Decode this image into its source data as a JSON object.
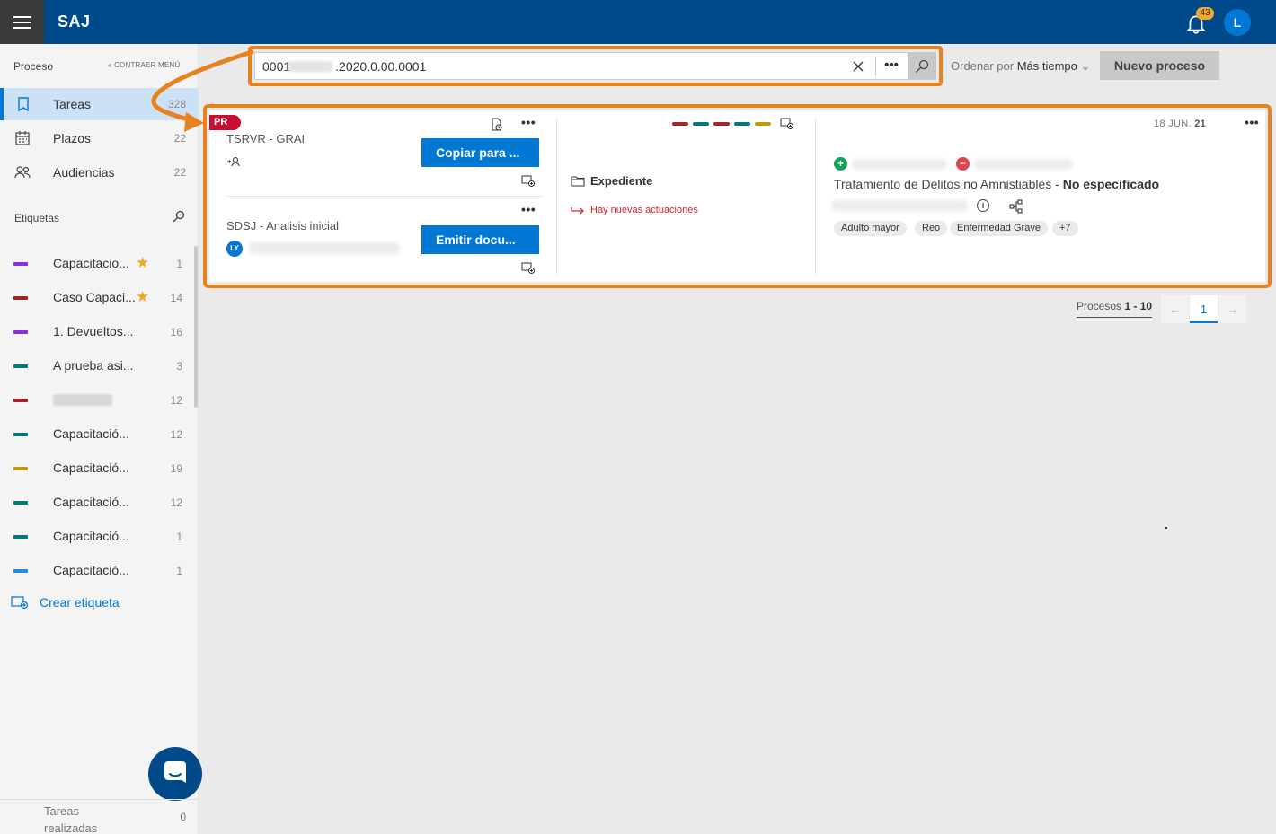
{
  "header": {
    "brand": "SAJ",
    "notifications_count": "43",
    "user_initial": "L"
  },
  "sidebar": {
    "section_title": "Proceso",
    "collapse_label": "« CONTRAER MENÚ",
    "nav": [
      {
        "label": "Tareas",
        "count": "328",
        "icon": "bookmark-icon",
        "active": true
      },
      {
        "label": "Plazos",
        "count": "22",
        "icon": "calendar-icon",
        "active": false
      },
      {
        "label": "Audiencias",
        "count": "22",
        "icon": "people-icon",
        "active": false
      }
    ],
    "tags_title": "Etiquetas",
    "tags": [
      {
        "label": "Capacitacio...",
        "count": "1",
        "color": "#8a2be2",
        "starred": true
      },
      {
        "label": "Caso Capaci...",
        "count": "14",
        "color": "#a4262c",
        "starred": true
      },
      {
        "label": "1. Devueltos...",
        "count": "16",
        "color": "#8a2be2",
        "starred": false
      },
      {
        "label": "A prueba asi...",
        "count": "3",
        "color": "#03787c",
        "starred": false
      },
      {
        "label": "",
        "count": "12",
        "color": "#a4262c",
        "starred": false,
        "redacted": true
      },
      {
        "label": "Capacitació...",
        "count": "12",
        "color": "#03787c",
        "starred": false
      },
      {
        "label": "Capacitació...",
        "count": "19",
        "color": "#c19c00",
        "starred": false
      },
      {
        "label": "Capacitació...",
        "count": "12",
        "color": "#03787c",
        "starred": false
      },
      {
        "label": "Capacitació...",
        "count": "1",
        "color": "#03787c",
        "starred": false
      },
      {
        "label": "Capacitació...",
        "count": "1",
        "color": "#2b88d8",
        "starred": false
      }
    ],
    "create_tag_label": "Crear etiqueta",
    "tasks_done_label": "Tareas realizadas",
    "tasks_done_count": "0"
  },
  "search": {
    "value_prefix": "0001",
    "value_suffix": ".2020.0.00.0001",
    "more_label": "•••"
  },
  "sort": {
    "prefix": "Ordenar por ",
    "value": "Más tiempo"
  },
  "new_process_label": "Nuevo proceso",
  "card": {
    "flag": "PR",
    "tasks": [
      {
        "title": "TSRVR - GRAI",
        "button": "Copiar para ..."
      },
      {
        "title": "SDSJ - Analisis inicial",
        "button": "Emitir docu...",
        "user_initials": "LY"
      }
    ],
    "status_colors": [
      "#a4262c",
      "#03787c",
      "#a4262c",
      "#03787c",
      "#c19c00"
    ],
    "expediente_label": "Expediente",
    "news_label": "Hay nuevas actuaciones",
    "date_day_month": "18 JUN. ",
    "date_year": "21",
    "crime_label": "Tratamiento de Delitos no Amnistiables - ",
    "crime_value": "No especificado",
    "chips": [
      "Adulto mayor",
      "Reo",
      "Enfermedad Grave",
      "+7"
    ]
  },
  "pagination": {
    "label": "Procesos ",
    "range": "1 - 10",
    "current_page": "1",
    "prev": "←",
    "next": "→"
  },
  "colors": {
    "brand_blue": "#004a8b",
    "accent_blue": "#0078d4",
    "highlight_orange": "#e8821e",
    "flag_red": "#c8102e"
  }
}
